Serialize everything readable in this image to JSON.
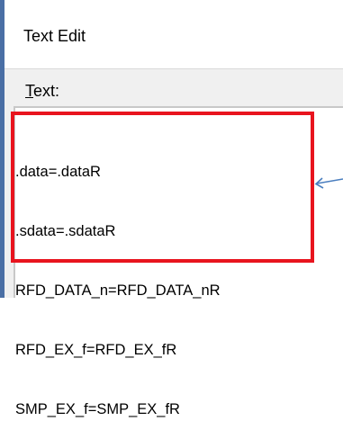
{
  "dialog": {
    "title": "Text Edit",
    "text_label_first": "T",
    "text_label_rest": "ext:"
  },
  "editor": {
    "lines": [
      ".data=.dataR",
      ".sdata=.sdataR",
      "RFD_DATA_n=RFD_DATA_nR",
      "RFD_EX_f=RFD_EX_fR",
      "SMP_EX_f=SMP_EX_fR"
    ]
  },
  "colors": {
    "highlight": "#e8141e",
    "arrow": "#4a7ebf"
  },
  "icons": {
    "arrow": "arrow-left-icon"
  }
}
